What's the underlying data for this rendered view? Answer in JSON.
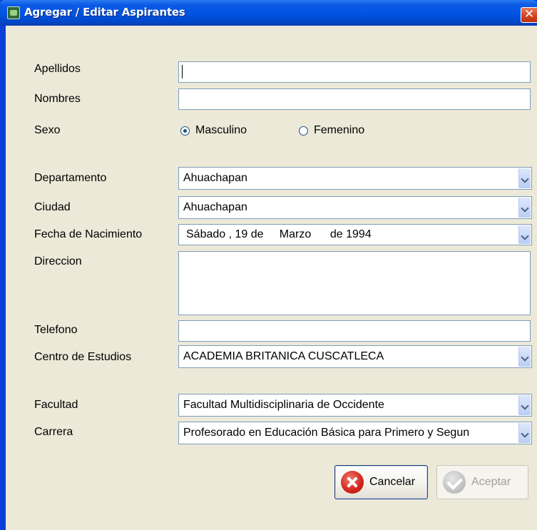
{
  "window": {
    "title": "Agregar / Editar Aspirantes",
    "close_glyph": "✕"
  },
  "labels": {
    "apellidos": "Apellidos",
    "nombres": "Nombres",
    "sexo": "Sexo",
    "departamento": "Departamento",
    "ciudad": "Ciudad",
    "fecha_nacimiento": "Fecha de Nacimiento",
    "direccion": "Direccion",
    "telefono": "Telefono",
    "centro_estudios": "Centro de Estudios",
    "facultad": "Facultad",
    "carrera": "Carrera"
  },
  "fields": {
    "apellidos": "",
    "nombres": "",
    "direccion": "",
    "telefono": ""
  },
  "sexo": {
    "options": [
      "Masculino",
      "Femenino"
    ],
    "selected": "Masculino"
  },
  "combos": {
    "departamento": "Ahuachapan",
    "ciudad": "Ahuachapan",
    "fecha_nacimiento": "Sábado , 19 de     Marzo      de 1994",
    "centro_estudios": "ACADEMIA BRITANICA CUSCATLECA",
    "facultad": "Facultad Multidisciplinaria de Occidente",
    "carrera": "Profesorado en Educación Básica para Primero y Segun"
  },
  "buttons": {
    "cancel": "Cancelar",
    "accept": "Aceptar",
    "accept_enabled": false
  },
  "icons": {
    "app": "app-icon",
    "close": "close-icon",
    "cancel": "cancel-x-icon",
    "accept": "check-icon",
    "dropdown": "chevron-down-icon"
  },
  "colors": {
    "titlebar": "#0053e1",
    "client_bg": "#ece9d8",
    "field_border": "#7f9db9",
    "close_button": "#d1421b",
    "cancel_icon": "#d2241b"
  }
}
